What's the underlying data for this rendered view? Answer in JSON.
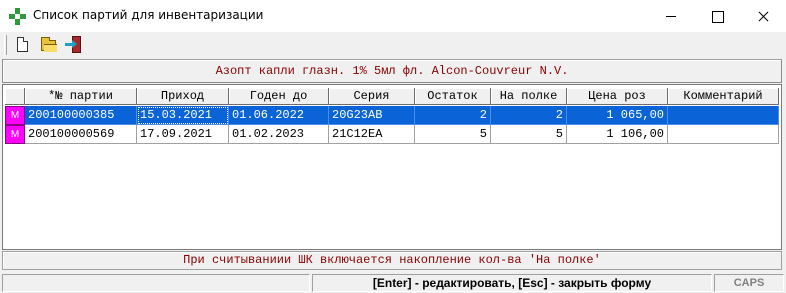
{
  "window": {
    "title": "Список партий для инвентаризации"
  },
  "toolbar": {
    "buttons": [
      {
        "name": "new-document-icon"
      },
      {
        "name": "open-folder-icon"
      },
      {
        "name": "exit-door-icon"
      }
    ]
  },
  "product": {
    "title": "Азопт капли глазн. 1% 5мл фл. Alcon-Couvreur N.V."
  },
  "table": {
    "columns": [
      "*№ партии",
      "Приход",
      "Годен до",
      "Серия",
      "Остаток",
      "На полке",
      "Цена роз",
      "Комментарий"
    ],
    "rows": [
      {
        "marker": "M",
        "cells": [
          "200100000385",
          "15.03.2021",
          "01.06.2022",
          "20G23AB",
          "2",
          "2",
          "1 065,00",
          ""
        ],
        "selected": true
      },
      {
        "marker": "M",
        "cells": [
          "200100000569",
          "17.09.2021",
          "01.02.2023",
          "21C12EA",
          "5",
          "5",
          "1 106,00",
          ""
        ],
        "selected": false
      }
    ]
  },
  "hint": "При считываниии ШК включается накопление кол-ва 'На полке'",
  "statusbar": {
    "panel1": "",
    "keys": "[Enter] - редактировать, [Esc] - закрыть форму",
    "caps": "CAPS"
  },
  "colors": {
    "selection": "#0a64d8",
    "marker": "#ff00ff",
    "accent_text": "#8b0000",
    "app_icon": "#2f9a3d"
  }
}
